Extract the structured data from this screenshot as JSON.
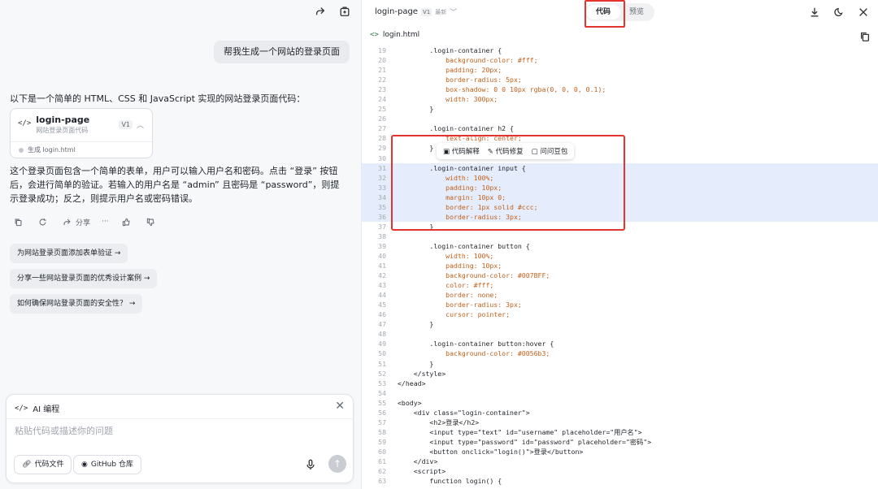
{
  "left": {
    "user_message": "帮我生成一个网站的登录页面",
    "intro": "以下是一个简单的 HTML、CSS 和 JavaScript 实现的网站登录页面代码：",
    "code_card": {
      "title": "login-page",
      "subtitle": "网站登录页面代码",
      "version": "V1",
      "status": "生成 login.html"
    },
    "reply": "这个登录页面包含一个简单的表单，用户可以输入用户名和密码。点击 “登录” 按钮后，会进行简单的验证。若输入的用户名是 “admin” 且密码是 “password”，则提示登录成功；反之，则提示用户名或密码错误。",
    "actions": {
      "share_label": "分享",
      "more": "···"
    },
    "suggestions": [
      "为网站登录页面添加表单验证 →",
      "分享一些网站登录页面的优秀设计案例 →",
      "如何确保网站登录页面的安全性？ →"
    ],
    "composer": {
      "header": "AI 编程",
      "placeholder": "粘贴代码或描述你的问题",
      "btn_code_file": "代码文件",
      "btn_github": "GitHub 仓库"
    }
  },
  "right": {
    "file_title": "login-page",
    "version": "V1",
    "latest": "最新",
    "tab_code": "代码",
    "tab_preview": "预览",
    "filename": "login.html",
    "hover_actions": [
      "代码解释",
      "代码修复",
      "问问豆包"
    ],
    "code_lines": [
      {
        "n": "19",
        "t": "        .login-container {"
      },
      {
        "n": "20",
        "t": "            background-color: #fff;",
        "p": true
      },
      {
        "n": "21",
        "t": "            padding: 20px;",
        "p": true
      },
      {
        "n": "22",
        "t": "            border-radius: 5px;",
        "p": true
      },
      {
        "n": "23",
        "t": "            box-shadow: 0 0 10px rgba(0, 0, 0, 0.1);",
        "p": true
      },
      {
        "n": "24",
        "t": "            width: 300px;",
        "p": true
      },
      {
        "n": "25",
        "t": "        }"
      },
      {
        "n": "26",
        "t": ""
      },
      {
        "n": "27",
        "t": "        .login-container h2 {"
      },
      {
        "n": "28",
        "t": "            text-align: center;",
        "p": true
      },
      {
        "n": "29",
        "t": "        }"
      },
      {
        "n": "30",
        "t": ""
      },
      {
        "n": "31",
        "t": "        .login-container input {",
        "s": true
      },
      {
        "n": "32",
        "t": "            width: 100%;",
        "p": true,
        "s": true
      },
      {
        "n": "33",
        "t": "            padding: 10px;",
        "p": true,
        "s": true
      },
      {
        "n": "34",
        "t": "            margin: 10px 0;",
        "p": true,
        "s": true
      },
      {
        "n": "35",
        "t": "            border: 1px solid #ccc;",
        "p": true,
        "s": true
      },
      {
        "n": "36",
        "t": "            border-radius: 3px;",
        "p": true,
        "s": true
      },
      {
        "n": "37",
        "t": "        }"
      },
      {
        "n": "38",
        "t": ""
      },
      {
        "n": "39",
        "t": "        .login-container button {"
      },
      {
        "n": "40",
        "t": "            width: 100%;",
        "p": true
      },
      {
        "n": "41",
        "t": "            padding: 10px;",
        "p": true
      },
      {
        "n": "42",
        "t": "            background-color: #007BFF;",
        "p": true
      },
      {
        "n": "43",
        "t": "            color: #fff;",
        "p": true
      },
      {
        "n": "44",
        "t": "            border: none;",
        "p": true
      },
      {
        "n": "45",
        "t": "            border-radius: 3px;",
        "p": true
      },
      {
        "n": "46",
        "t": "            cursor: pointer;",
        "p": true
      },
      {
        "n": "47",
        "t": "        }"
      },
      {
        "n": "48",
        "t": ""
      },
      {
        "n": "49",
        "t": "        .login-container button:hover {"
      },
      {
        "n": "50",
        "t": "            background-color: #0056b3;",
        "p": true
      },
      {
        "n": "51",
        "t": "        }"
      },
      {
        "n": "52",
        "t": "    </style>"
      },
      {
        "n": "53",
        "t": "</head>"
      },
      {
        "n": "54",
        "t": ""
      },
      {
        "n": "55",
        "t": "<body>"
      },
      {
        "n": "56",
        "t": "    <div class=\"login-container\">"
      },
      {
        "n": "57",
        "t": "        <h2>登录</h2>"
      },
      {
        "n": "58",
        "t": "        <input type=\"text\" id=\"username\" placeholder=\"用户名\">"
      },
      {
        "n": "59",
        "t": "        <input type=\"password\" id=\"password\" placeholder=\"密码\">"
      },
      {
        "n": "60",
        "t": "        <button onclick=\"login()\">登录</button>"
      },
      {
        "n": "61",
        "t": "    </div>"
      },
      {
        "n": "62",
        "t": "    <script>"
      },
      {
        "n": "63",
        "t": "        function login() {"
      }
    ]
  },
  "colors": {
    "highlight_box": "#e5342f",
    "selection": "#e5ecfb",
    "css_property": "#c1611b"
  }
}
